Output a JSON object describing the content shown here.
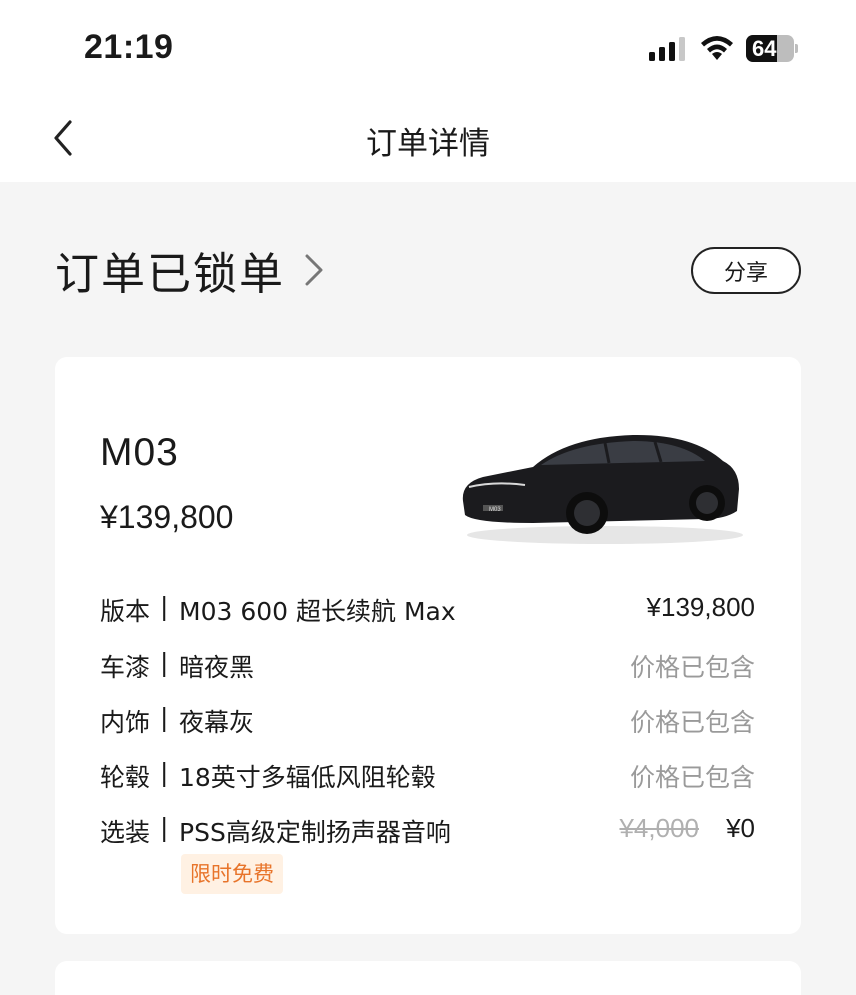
{
  "status_bar": {
    "time": "21:19",
    "battery": "64",
    "battery_level": 0.64
  },
  "nav": {
    "title": "订单详情",
    "back_icon": "chevron-left-icon"
  },
  "order": {
    "status": "订单已锁单",
    "share_label": "分享"
  },
  "vehicle": {
    "model": "M03",
    "price": "¥139,800",
    "specs": [
      {
        "label": "版本",
        "sep": "|",
        "value": "M03 600 超长续航 Max",
        "price": "¥139,800"
      },
      {
        "label": "车漆",
        "sep": "|",
        "value": "暗夜黑",
        "price": "价格已包含"
      },
      {
        "label": "内饰",
        "sep": "|",
        "value": "夜幕灰",
        "price": "价格已包含"
      },
      {
        "label": "轮毂",
        "sep": "|",
        "value": "18英寸多辐低风阻轮毂",
        "price": "价格已包含"
      },
      {
        "label": "选装",
        "sep": "|",
        "value": "PSS高级定制扬声器音响",
        "original_price": "¥4,000",
        "price": "¥0"
      }
    ],
    "promo": "限时免费"
  },
  "colors": {
    "background": "#f5f5f5",
    "card": "#ffffff",
    "muted_text": "#9a9a9a",
    "promo_text": "#e8742a",
    "promo_bg": "#fff1e3"
  }
}
